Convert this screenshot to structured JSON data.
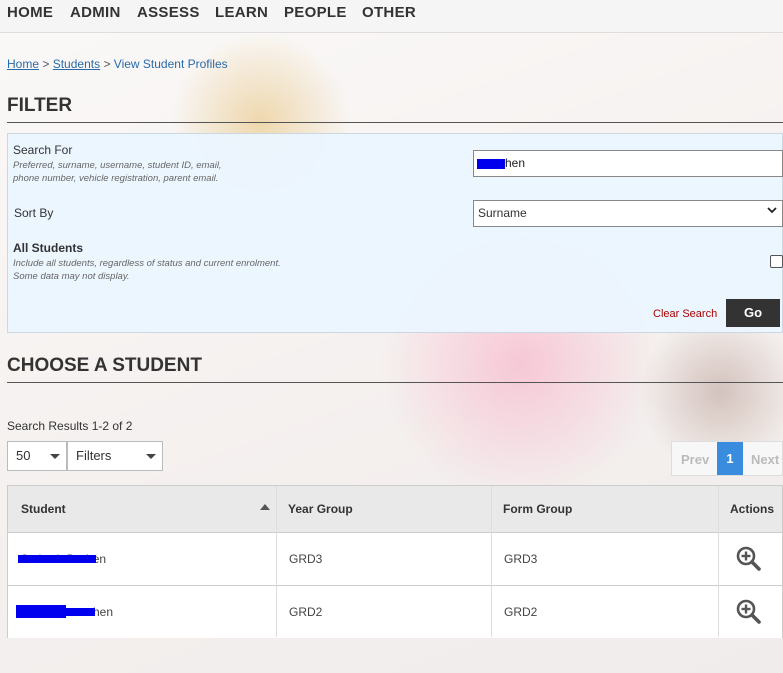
{
  "nav": {
    "items": [
      "HOME",
      "ADMIN",
      "ASSESS",
      "LEARN",
      "PEOPLE",
      "OTHER"
    ]
  },
  "breadcrumb": {
    "home": "Home",
    "sep1": ">",
    "students": "Students",
    "sep2": ">",
    "current": "View Student Profiles"
  },
  "filter": {
    "title": "FILTER",
    "search_label": "Search For",
    "search_hint_1": "Preferred, surname, username, student ID, email,",
    "search_hint_2": "phone number, vehicle registration, parent email.",
    "search_value": "hen",
    "sort_label": "Sort By",
    "sort_value": "Surname",
    "all_label": "All Students",
    "all_hint_1": "Include all students, regardless of status and current enrolment.",
    "all_hint_2": "Some data may not display.",
    "clear_label": "Clear Search",
    "go_label": "Go"
  },
  "choose": {
    "title": "CHOOSE A STUDENT",
    "results_text": "Search Results 1-2 of 2",
    "per_page": "50",
    "filters_label": "Filters",
    "pager": {
      "prev": "Prev",
      "page": "1",
      "next": "Next"
    }
  },
  "table": {
    "headers": {
      "student": "Student",
      "year": "Year Group",
      "form": "Form Group",
      "actions": "Actions"
    },
    "rows": [
      {
        "student": "Otsiwah Dorhen",
        "year": "GRD3",
        "form": "GRD3"
      },
      {
        "student": "hen",
        "year": "GRD2",
        "form": "GRD2"
      }
    ]
  },
  "colors": {
    "accent": "#3a8dde",
    "go_button": "#333333",
    "clear_link": "#aa0000",
    "redaction": "#0000ee",
    "filter_panel": "#ebf6ff"
  },
  "icons": {
    "row_action": "zoom-in-icon",
    "sort": "sort-up-icon",
    "dropdown": "chevron-down-icon"
  }
}
